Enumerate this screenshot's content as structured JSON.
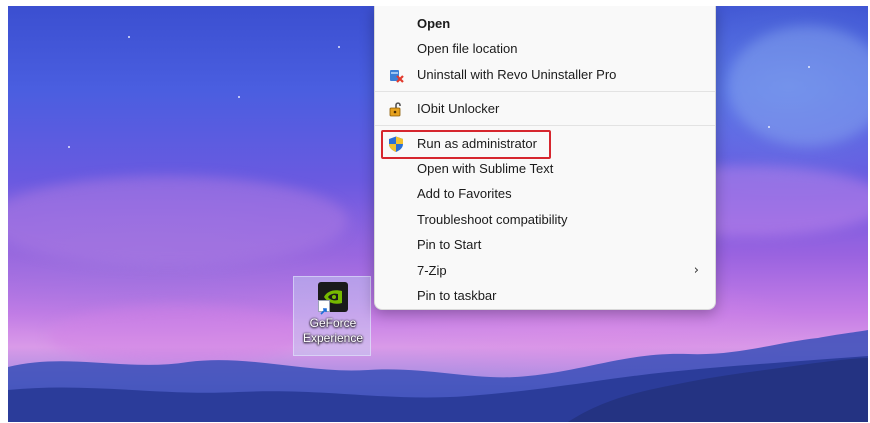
{
  "desktop_icon": {
    "label_line1": "GeForce",
    "label_line2": "Experience",
    "icon": "nvidia-icon"
  },
  "context_menu": {
    "items": [
      {
        "label": "Open",
        "icon": "",
        "bold": true
      },
      {
        "label": "Open file location",
        "icon": ""
      },
      {
        "label": "Uninstall with Revo Uninstaller Pro",
        "icon": "revo-uninstaller-icon"
      },
      {
        "label": "IObit Unlocker",
        "icon": "iobit-unlocker-icon"
      },
      {
        "label": "Run as administrator",
        "icon": "uac-shield-icon",
        "highlighted": true
      },
      {
        "label": "Open with Sublime Text",
        "icon": ""
      },
      {
        "label": "Add to Favorites",
        "icon": ""
      },
      {
        "label": "Troubleshoot compatibility",
        "icon": ""
      },
      {
        "label": "Pin to Start",
        "icon": ""
      },
      {
        "label": "7-Zip",
        "icon": "",
        "submenu": "›"
      },
      {
        "label": "Pin to taskbar",
        "icon": ""
      }
    ]
  },
  "colors": {
    "highlight_border": "#d6262e",
    "menu_background": "#f9f9f9"
  }
}
